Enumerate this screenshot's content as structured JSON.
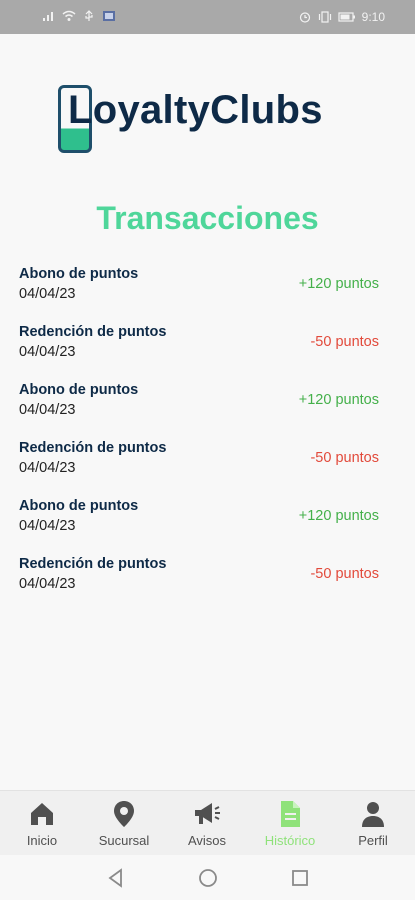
{
  "status_bar": {
    "time": "9:10",
    "icons": [
      "signal-icon",
      "wifi-icon",
      "usb-icon",
      "nfc-icon",
      "alarm-icon",
      "vibrate-icon",
      "battery-icon"
    ]
  },
  "header": {
    "logo_text": "LoyaltyClubs"
  },
  "main": {
    "title": "Transacciones",
    "transactions": [
      {
        "type": "Abono de puntos",
        "date": "04/04/23",
        "amount": "+120 puntos",
        "kind": "positive"
      },
      {
        "type": "Redención de puntos",
        "date": "04/04/23",
        "amount": "-50 puntos",
        "kind": "negative"
      },
      {
        "type": "Abono de puntos",
        "date": "04/04/23",
        "amount": "+120 puntos",
        "kind": "positive"
      },
      {
        "type": "Redención de puntos",
        "date": "04/04/23",
        "amount": "-50 puntos",
        "kind": "negative"
      },
      {
        "type": "Abono de puntos",
        "date": "04/04/23",
        "amount": "+120 puntos",
        "kind": "positive"
      },
      {
        "type": "Redención de puntos",
        "date": "04/04/23",
        "amount": "-50 puntos",
        "kind": "negative"
      }
    ]
  },
  "bottom_nav": {
    "items": [
      {
        "label": "Inicio",
        "icon": "home-icon"
      },
      {
        "label": "Sucursal",
        "icon": "location-pin-icon"
      },
      {
        "label": "Avisos",
        "icon": "megaphone-icon"
      },
      {
        "label": "Histórico",
        "icon": "document-icon",
        "active": true
      },
      {
        "label": "Perfil",
        "icon": "person-icon"
      }
    ]
  },
  "colors": {
    "title": "#4fd69a",
    "positive": "#44b04a",
    "negative": "#e24a3b",
    "brand_dark": "#0e2a47",
    "active_tab": "#8fe27a"
  }
}
